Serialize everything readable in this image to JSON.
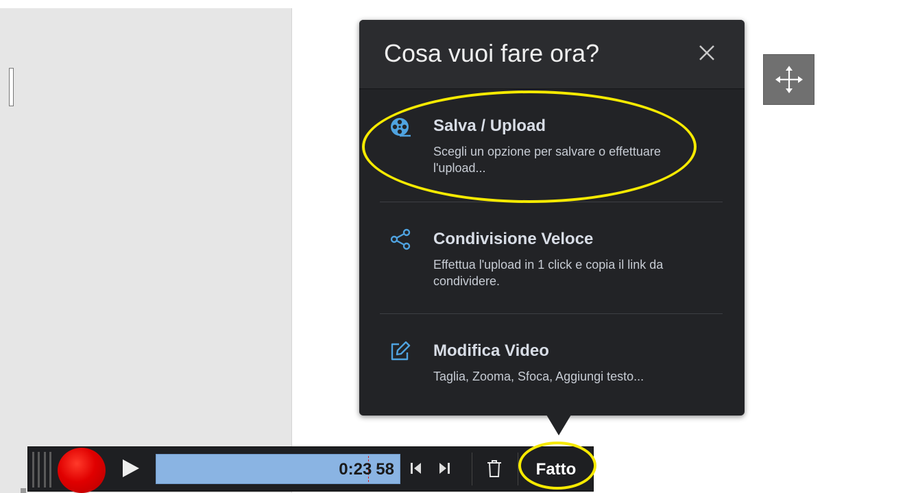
{
  "popup": {
    "title": "Cosa vuoi fare ora?",
    "options": [
      {
        "icon": "film-reel-icon",
        "title": "Salva / Upload",
        "description": "Scegli un opzione per salvare o effettuare l'upload..."
      },
      {
        "icon": "share-icon",
        "title": "Condivisione Veloce",
        "description": "Effettua l'upload in 1 click e copia il link da condividere."
      },
      {
        "icon": "edit-icon",
        "title": "Modifica Video",
        "description": "Taglia, Zooma, Sfoca, Aggiungi testo..."
      }
    ]
  },
  "toolbar": {
    "time": "0:23",
    "time_fraction": "58",
    "done_label": "Fatto"
  },
  "colors": {
    "accent_icon": "#4fa3e0",
    "highlight": "#f7ea00",
    "record": "#e00000",
    "timeline": "#8ab4e3"
  }
}
